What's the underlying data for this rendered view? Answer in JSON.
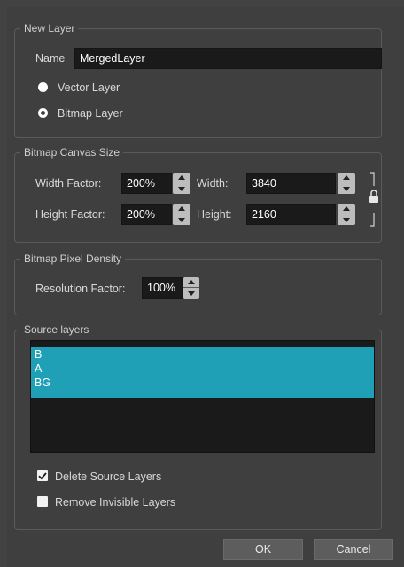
{
  "new_layer": {
    "title": "New Layer",
    "name_label": "Name",
    "name_value": "MergedLayer",
    "vector_label": "Vector Layer",
    "bitmap_label": "Bitmap Layer",
    "selected": "bitmap"
  },
  "canvas_size": {
    "title": "Bitmap Canvas Size",
    "width_factor_label": "Width Factor:",
    "width_factor_value": "200%",
    "height_factor_label": "Height Factor:",
    "height_factor_value": "200%",
    "width_label": "Width:",
    "width_value": "3840",
    "height_label": "Height:",
    "height_value": "2160",
    "lock_icon": "lock-icon"
  },
  "pixel_density": {
    "title": "Bitmap Pixel Density",
    "resolution_label": "Resolution Factor:",
    "resolution_value": "100%"
  },
  "source_layers": {
    "title": "Source layers",
    "items": [
      "B",
      "A",
      "BG"
    ],
    "delete_label": "Delete Source Layers",
    "delete_checked": true,
    "remove_invisible_label": "Remove Invisible Layers",
    "remove_invisible_checked": false
  },
  "buttons": {
    "ok": "OK",
    "cancel": "Cancel"
  },
  "colors": {
    "selection": "#1fa0b7",
    "background": "#3f3f3f",
    "field": "#1a1a1a"
  }
}
